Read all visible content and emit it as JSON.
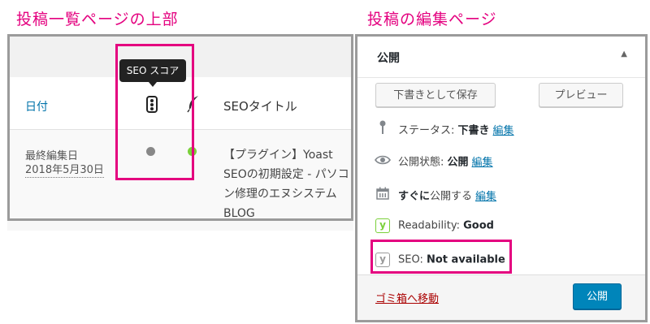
{
  "captions": {
    "left": "投稿一覧ページの上部",
    "right": "投稿の編集ページ"
  },
  "post_list": {
    "tooltip": "SEO スコア",
    "columns": {
      "date": "日付",
      "seo_score_icon": "traffic-light-icon",
      "readability_icon": "feather-icon",
      "seo_title": "SEOタイトル"
    },
    "row": {
      "date_label": "最終編集日",
      "date_value": "2018年5月30日",
      "seo_status_color": "#888888",
      "readability_status_color": "#7ad03a",
      "seo_title": "【プラグイン】Yoast SEOの初期設定 - パソコン修理のエヌシステムBLOG"
    }
  },
  "publish_box": {
    "title": "公開",
    "toggle": "▲",
    "save_draft": "下書きとして保存",
    "preview": "プレビュー",
    "status_label": "ステータス:",
    "status_value": "下書き",
    "visibility_label": "公開状態:",
    "visibility_value": "公開",
    "schedule_label_bold": "すぐに",
    "schedule_label": "公開する",
    "edit": "編集",
    "readability_label": "Readability:",
    "readability_value": "Good",
    "seo_label": "SEO:",
    "seo_value": "Not available",
    "yoast_glyph": "y",
    "trash": "ゴミ箱へ移動",
    "publish": "公開"
  },
  "colors": {
    "highlight": "#e4007f",
    "link": "#0073aa",
    "primary_button": "#0085ba",
    "trash": "#aa0000"
  }
}
